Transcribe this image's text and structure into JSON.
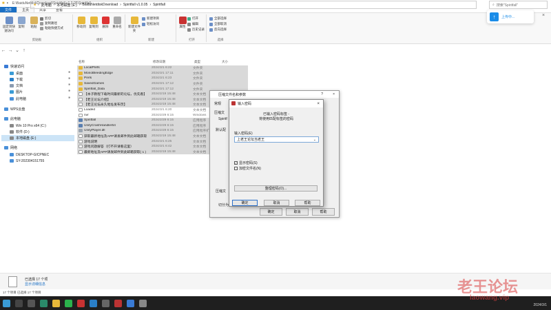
{
  "window": {
    "path": "E:\\BaiduNetdiskDownload\\Spiritfall v1.0.05\\Spiritfall",
    "tabs": [
      "文件",
      "主页",
      "共享",
      "查看"
    ]
  },
  "ribbon": {
    "groups": [
      "剪贴板",
      "组织",
      "新建",
      "打开",
      "选择"
    ],
    "clipboard": [
      "固定到快速访问",
      "复制",
      "粘贴",
      "剪切",
      "复制路径",
      "粘贴快捷方式"
    ],
    "organize": [
      "移动到",
      "复制到",
      "删除",
      "重命名"
    ],
    "new": [
      "新建文件夹",
      "新建项目",
      "轻松访问"
    ],
    "open": [
      "属性",
      "打开",
      "编辑",
      "历史记录"
    ],
    "select": [
      "全部选择",
      "全部取消",
      "反向选择"
    ]
  },
  "address": {
    "crumbs": [
      "此电脑",
      "本地磁盘 (E:)",
      "BaiduNetdiskDownload",
      "Spiritfall v1.0.05",
      "Spiritfall"
    ],
    "search_placeholder": "搜索\"Spiritfall\""
  },
  "nav": {
    "items": [
      {
        "label": "快速访问",
        "pinned": false
      },
      {
        "label": "桌面",
        "pinned": true
      },
      {
        "label": "下载",
        "pinned": true
      },
      {
        "label": "文档",
        "pinned": true
      },
      {
        "label": "图片",
        "pinned": true
      },
      {
        "label": "此电脑",
        "pinned": true
      },
      {
        "label": "WPS云盘",
        "pinned": false
      },
      {
        "label": "此电脑",
        "pinned": false
      },
      {
        "label": "Win 10 Pro x64 (C:)",
        "pinned": false
      },
      {
        "label": "软件 (D:)",
        "pinned": false
      },
      {
        "label": "本地磁盘 (E:)",
        "pinned": false
      },
      {
        "label": "网络",
        "pinned": false
      },
      {
        "label": "DESKTOP-GICPNEC",
        "pinned": false
      },
      {
        "label": "SY-202304151755",
        "pinned": false
      }
    ]
  },
  "files": {
    "headers": [
      "名称",
      "修改日期",
      "类型",
      "大小"
    ],
    "rows": [
      {
        "name": "LocalPrefs",
        "date": "2024/3/1 6:22",
        "type": "文件夹",
        "icon": "folder",
        "selected": true
      },
      {
        "name": "MonoBleedingEdge",
        "date": "2024/3/1 17:11",
        "type": "文件夹",
        "icon": "folder",
        "selected": true
      },
      {
        "name": "Prefs",
        "date": "2024/3/1 6:23",
        "type": "文件夹",
        "icon": "folder",
        "selected": true
      },
      {
        "name": "SavedGames",
        "date": "2024/3/1 17:12",
        "type": "文件夹",
        "icon": "folder",
        "selected": true
      },
      {
        "name": "Spiritfall_Data",
        "date": "2024/3/1 17:12",
        "type": "文件夹",
        "icon": "folder",
        "selected": true
      },
      {
        "name": "【本子教程下载时间最新的论坛，优先看】",
        "date": "2024/2/19 15:48",
        "type": "文本文档",
        "icon": "text",
        "selected": true
      },
      {
        "name": "【老王论坛介绍】",
        "date": "2024/2/19 15:48",
        "type": "文本文档",
        "icon": "text",
        "selected": true
      },
      {
        "name": "【老王论坛永久地址发布页】",
        "date": "2024/2/19 15:48",
        "type": "文本文档",
        "icon": "text",
        "selected": true
      },
      {
        "name": "Loaded",
        "date": "2024/3/1 6:20",
        "type": "文本文档",
        "icon": "text",
        "selected": false
      },
      {
        "name": "nvr",
        "date": "2024/2/29 6:15",
        "type": "Windows",
        "icon": "text",
        "selected": false
      },
      {
        "name": "Spiritfall",
        "date": "2024/2/29 6:15",
        "type": "应用程序",
        "icon": "app",
        "selected": true
      },
      {
        "name": "UnityCrashHandler64",
        "date": "2024/2/29 6:15",
        "type": "应用程序",
        "icon": "app",
        "selected": true
      },
      {
        "name": "UnityPlayer.dll",
        "date": "2024/2/29 6:15",
        "type": "应用程序扩展",
        "icon": "dll",
        "selected": true
      },
      {
        "name": "获取最新地址及APP请发邮件到此邮箱获取",
        "date": "2024/2/19 15:48",
        "type": "文本文档",
        "icon": "text",
        "selected": true
      },
      {
        "name": "游戏说明",
        "date": "2024/3/1 6:25",
        "type": "文本文档",
        "icon": "text",
        "selected": true
      },
      {
        "name": "游戏问题解答（打不开请看这里）",
        "date": "2024/3/1 6:42",
        "type": "文本文档",
        "icon": "text",
        "selected": true
      },
      {
        "name": "最新地址及APP请发邮件到此邮箱获取( 1 )",
        "date": "2024/2/19 15:48",
        "type": "文本文档",
        "icon": "text",
        "selected": true
      }
    ]
  },
  "details": {
    "line1": "已选择 17 个项",
    "line2": "显示详细信息"
  },
  "status": {
    "text": "17 个项目   已选择 17 个项目"
  },
  "archive_dialog": {
    "title": "压缩文件名和参数",
    "tab": "常规",
    "labels": [
      "压缩文",
      "Spiritf",
      "默认配",
      "压缩文",
      "切分为"
    ],
    "buttons": [
      "确定",
      "取消",
      "帮助"
    ]
  },
  "password_dialog": {
    "title": "输入密码",
    "msg1": "已输入密码标签 -",
    "msg2": "将使用匹配标签的密码",
    "label": "输入密码(E)",
    "value": "上老王论坛当老王",
    "show_password": "显示密码(S)",
    "encrypt_names": "加密文件名(N)",
    "organize_button": "整理密码(O)...",
    "ok": "确定",
    "cancel": "取消",
    "help": "帮助"
  },
  "upload": {
    "label": "上传中..."
  },
  "watermark": {
    "line1": "老王论坛",
    "line2": "laowang.vip"
  },
  "tray": {
    "date": "2024/3/1"
  }
}
